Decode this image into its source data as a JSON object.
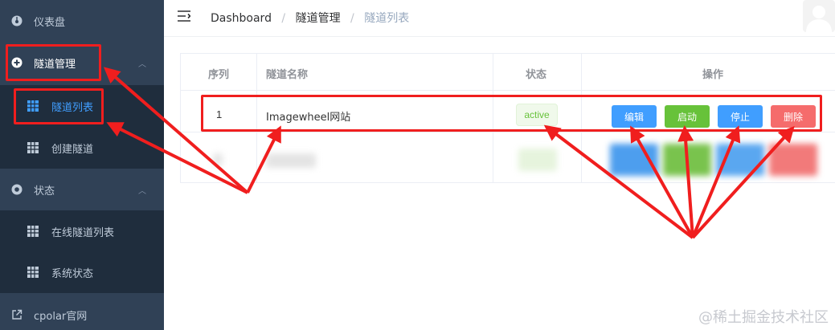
{
  "sidebar": {
    "items": [
      {
        "label": "仪表盘",
        "icon": "dashboard-icon"
      },
      {
        "label": "隧道管理",
        "icon": "tunnel-icon"
      },
      {
        "label": "隧道列表",
        "icon": "grid-icon"
      },
      {
        "label": "创建隧道",
        "icon": "grid-icon"
      },
      {
        "label": "状态",
        "icon": "status-icon"
      },
      {
        "label": "在线隧道列表",
        "icon": "grid-icon"
      },
      {
        "label": "系统状态",
        "icon": "grid-icon"
      },
      {
        "label": "cpolar官网",
        "icon": "external-link-icon"
      }
    ]
  },
  "breadcrumb": {
    "home": "Dashboard",
    "section": "隧道管理",
    "current": "隧道列表",
    "separator": "/"
  },
  "table": {
    "headers": [
      "序列",
      "隧道名称",
      "状态",
      "操作"
    ],
    "rows": [
      {
        "index": "1",
        "name": "Imagewheel网站",
        "status": "active"
      }
    ],
    "actions": [
      "编辑",
      "启动",
      "停止",
      "删除"
    ]
  },
  "colors": {
    "sidebar_bg": "#304156",
    "submenu_bg": "#1f2d3d",
    "primary": "#409eff",
    "success": "#67c23a",
    "danger": "#f56c6c",
    "annotation": "#f01e1e"
  },
  "watermark": "@稀土掘金技术社区"
}
